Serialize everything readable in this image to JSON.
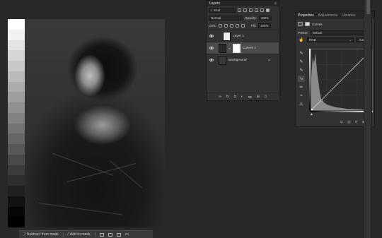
{
  "mask_toolbar": {
    "subtract_label": "Subtract from mask",
    "add_label": "Add to mask",
    "more_label": "•••"
  },
  "layers_panel": {
    "title": "Layers",
    "filter_kind": "Kind",
    "blend_mode": "Normal",
    "opacity_label": "Opacity:",
    "opacity_value": "100%",
    "lock_label": "Lock:",
    "fill_label": "Fill:",
    "fill_value": "100%",
    "layers": [
      {
        "name": "Layer 1"
      },
      {
        "name": "Curves 1"
      },
      {
        "name": "Background"
      }
    ]
  },
  "properties_panel": {
    "tabs": [
      "Properties",
      "Adjustments",
      "Libraries"
    ],
    "adjustment_name": "Curves",
    "preset_label": "Preset:",
    "preset_value": "Default",
    "channel_value": "RGB",
    "auto_label": "Auto"
  },
  "colors": {
    "workspace_bg": "#282828",
    "panel_bg": "#323232",
    "selected_row": "#4b4b4b"
  },
  "grayscale_steps": [
    "#ffffff",
    "#f2f2f2",
    "#e4e4e4",
    "#d6d6d6",
    "#c8c8c8",
    "#bababa",
    "#acacac",
    "#9e9e9e",
    "#909090",
    "#828282",
    "#747474",
    "#666666",
    "#585858",
    "#4a4a4a",
    "#3c3c3c",
    "#2e2e2e",
    "#202020",
    "#121212",
    "#060606",
    "#000000"
  ]
}
